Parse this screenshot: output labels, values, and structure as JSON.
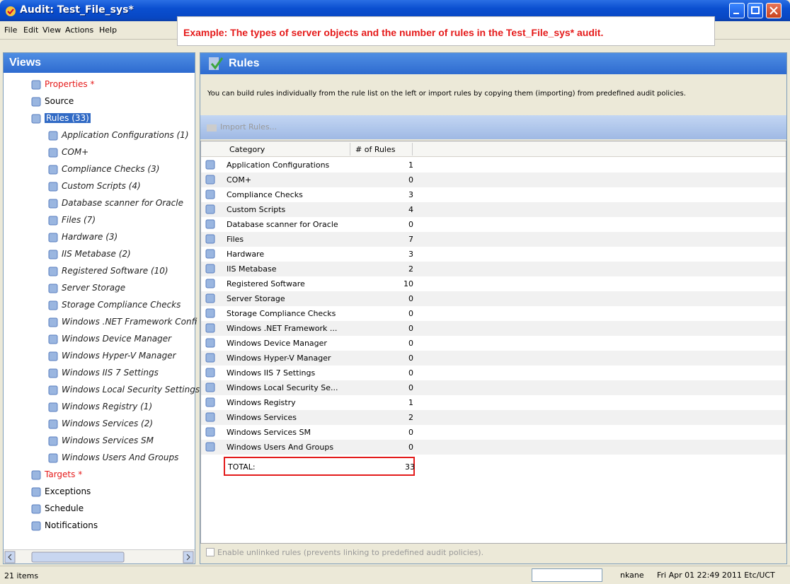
{
  "window": {
    "title": "Audit: Test_File_sys*"
  },
  "menu": [
    "File",
    "Edit",
    "View",
    "Actions",
    "Help"
  ],
  "callout": "Example: The types of server objects and the number of rules in the Test_File_sys* audit.",
  "views": {
    "title": "Views",
    "items": [
      {
        "label": "Properties *",
        "icon": "properties-icon",
        "red": true,
        "child": false
      },
      {
        "label": "Source",
        "icon": "source-icon",
        "red": false,
        "child": false
      },
      {
        "label": "Rules (33)",
        "icon": "rules-icon",
        "red": false,
        "child": false,
        "selected": true
      },
      {
        "label": "Application Configurations (1)",
        "icon": "app-config-icon",
        "child": true
      },
      {
        "label": "COM+",
        "icon": "com-icon",
        "child": true
      },
      {
        "label": "Compliance Checks (3)",
        "icon": "compliance-icon",
        "child": true
      },
      {
        "label": "Custom Scripts (4)",
        "icon": "scripts-icon",
        "child": true
      },
      {
        "label": "Database scanner for Oracle",
        "icon": "database-icon",
        "child": true
      },
      {
        "label": "Files (7)",
        "icon": "folder-icon",
        "child": true
      },
      {
        "label": "Hardware (3)",
        "icon": "hardware-icon",
        "child": true
      },
      {
        "label": "IIS Metabase (2)",
        "icon": "iis-icon",
        "child": true
      },
      {
        "label": "Registered Software (10)",
        "icon": "software-icon",
        "child": true
      },
      {
        "label": "Server Storage",
        "icon": "storage-icon",
        "child": true
      },
      {
        "label": "Storage Compliance Checks",
        "icon": "storage-check-icon",
        "child": true
      },
      {
        "label": "Windows .NET Framework Confi",
        "icon": "dotnet-icon",
        "child": true
      },
      {
        "label": "Windows Device Manager",
        "icon": "device-manager-icon",
        "child": true
      },
      {
        "label": "Windows Hyper-V Manager",
        "icon": "hyperv-icon",
        "child": true
      },
      {
        "label": "Windows IIS 7 Settings",
        "icon": "iis7-icon",
        "child": true
      },
      {
        "label": "Windows Local Security Settings",
        "icon": "security-icon",
        "child": true
      },
      {
        "label": "Windows Registry (1)",
        "icon": "registry-icon",
        "child": true
      },
      {
        "label": "Windows Services (2)",
        "icon": "services-icon",
        "child": true
      },
      {
        "label": "Windows Services SM",
        "icon": "services-sm-icon",
        "child": true
      },
      {
        "label": "Windows Users And Groups",
        "icon": "users-icon",
        "child": true
      },
      {
        "label": "Targets *",
        "icon": "targets-icon",
        "red": true,
        "child": false
      },
      {
        "label": "Exceptions",
        "icon": "exceptions-icon",
        "child": false
      },
      {
        "label": "Schedule",
        "icon": "schedule-icon",
        "child": false
      },
      {
        "label": "Notifications",
        "icon": "notifications-icon",
        "child": false
      }
    ]
  },
  "rules": {
    "title": "Rules",
    "description": "You can build rules individually from the rule list on the left or import rules by copying them (importing) from predefined audit policies.",
    "import_label": "Import Rules...",
    "headers": [
      "Category",
      "# of Rules"
    ],
    "rows": [
      [
        "Application Configurations",
        "1"
      ],
      [
        "COM+",
        "0"
      ],
      [
        "Compliance Checks",
        "3"
      ],
      [
        "Custom Scripts",
        "4"
      ],
      [
        "Database scanner for Oracle",
        "0"
      ],
      [
        "Files",
        "7"
      ],
      [
        "Hardware",
        "3"
      ],
      [
        "IIS Metabase",
        "2"
      ],
      [
        "Registered Software",
        "10"
      ],
      [
        "Server Storage",
        "0"
      ],
      [
        "Storage Compliance Checks",
        "0"
      ],
      [
        "Windows .NET Framework ...",
        "0"
      ],
      [
        "Windows Device Manager",
        "0"
      ],
      [
        "Windows Hyper-V Manager",
        "0"
      ],
      [
        "Windows IIS 7 Settings",
        "0"
      ],
      [
        "Windows Local Security Se...",
        "0"
      ],
      [
        "Windows Registry",
        "1"
      ],
      [
        "Windows Services",
        "2"
      ],
      [
        "Windows Services SM",
        "0"
      ],
      [
        "Windows Users And Groups",
        "0"
      ]
    ],
    "total_label": "TOTAL:",
    "total_value": "33",
    "enable_unlinked": "Enable unlinked rules (prevents linking to predefined audit policies)."
  },
  "status": {
    "items": "21 items",
    "user": "nkane",
    "time": "Fri Apr 01 22:49 2011 Etc/UCT"
  }
}
